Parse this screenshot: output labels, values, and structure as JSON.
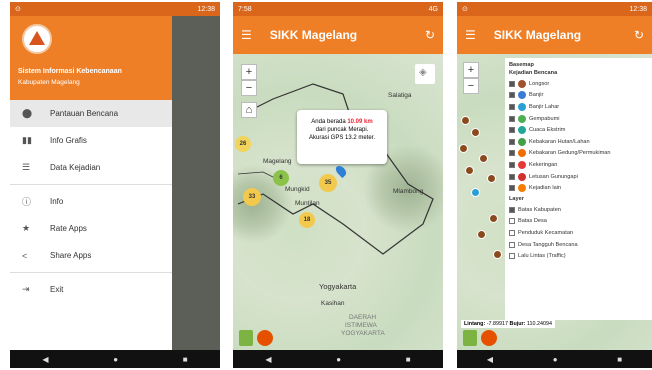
{
  "app": {
    "title": "SIKK Magelang",
    "refresh_icon": "refresh-icon"
  },
  "status": {
    "time1": "12:38",
    "time2": "7:58",
    "time3": "12:38",
    "net2": "4G"
  },
  "drawer": {
    "app_name": "Sistem Informasi Kebencanaan",
    "org": "Kabupaten Magelang",
    "items": [
      {
        "label": "Pantauan Bencana",
        "icon": "location-icon"
      },
      {
        "label": "Info Grafis",
        "icon": "bar-chart-icon"
      },
      {
        "label": "Data Kejadian",
        "icon": "list-icon"
      },
      {
        "label": "Info",
        "icon": "info-icon"
      },
      {
        "label": "Rate Apps",
        "icon": "star-icon"
      },
      {
        "label": "Share Apps",
        "icon": "share-icon"
      },
      {
        "label": "Exit",
        "icon": "exit-icon"
      }
    ]
  },
  "map2": {
    "popup_l1": "Anda berada",
    "popup_dist": "10.09 km",
    "popup_l2": "dari puncak Merapi.",
    "popup_l3": "Akurasi GPS 13.2 meter.",
    "clusters": [
      "26",
      "6",
      "35",
      "33",
      "18"
    ],
    "labels": [
      "Salatiga",
      "Mungkid",
      "Muntilan",
      "Yogyakarta",
      "Kasihan",
      "DAERAH",
      "ISTIMEWA",
      "YOGYAKARTA",
      "Magelang",
      "Mlambong"
    ]
  },
  "layers": {
    "basemap": "Basemap",
    "group1": "Kejadian Bencana",
    "items1": [
      {
        "label": "Longsor",
        "color": "#a0522d"
      },
      {
        "label": "Banjir",
        "color": "#3a7bd5"
      },
      {
        "label": "Banjir Lahar",
        "color": "#2a9fd6"
      },
      {
        "label": "Gempabumi",
        "color": "#4caf50"
      },
      {
        "label": "Cuaca Ekstrim",
        "color": "#26a69a"
      },
      {
        "label": "Kebakaran Hutan/Lahan",
        "color": "#43a047"
      },
      {
        "label": "Kebakaran Gedung/Permukiman",
        "color": "#ef6c00"
      },
      {
        "label": "Kekeringan",
        "color": "#e53935"
      },
      {
        "label": "Letusan Gunungapi",
        "color": "#d32f2f"
      },
      {
        "label": "Kejadian lain",
        "color": "#f57c00"
      }
    ],
    "group2": "Layer",
    "items2": [
      {
        "label": "Batas Kabupaten",
        "on": true
      },
      {
        "label": "Batas Desa",
        "on": false
      },
      {
        "label": "Penduduk Kecamatan",
        "on": false
      },
      {
        "label": "Desa Tangguh Bencana",
        "on": false
      },
      {
        "label": "Lalu Lintas (Traffic)",
        "on": false
      }
    ],
    "coords_label1": "Lintang:",
    "coords_val1": "-7.89917",
    "coords_label2": "Bujur:",
    "coords_val2": "110.24094"
  }
}
